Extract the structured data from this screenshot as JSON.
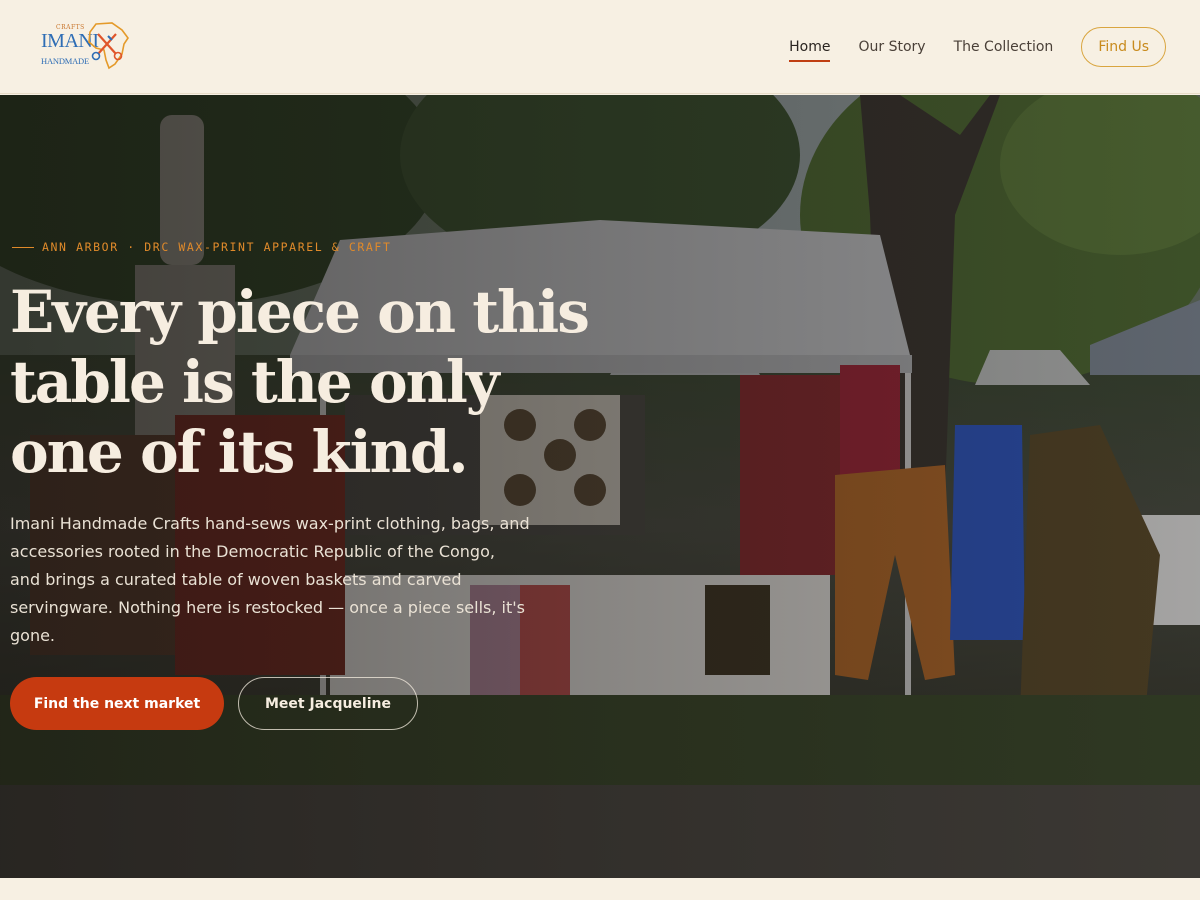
{
  "brand": {
    "logo_small": "CRAFTS",
    "logo_main": "IMANI",
    "logo_sub": "HANDMADE"
  },
  "nav": {
    "items": [
      {
        "label": "Home",
        "active": true
      },
      {
        "label": "Our Story",
        "active": false
      },
      {
        "label": "The Collection",
        "active": false
      }
    ],
    "cta_label": "Find Us"
  },
  "hero": {
    "eyebrow": "ANN ARBOR · DRC WAX-PRINT APPAREL & CRAFT",
    "headline": "Every piece on this table is the only one of its kind.",
    "lede": "Imani Handmade Crafts hand-sews wax-print clothing, bags, and accessories rooted in the Democratic Republic of the Congo, and brings a curated table of woven baskets and carved servingware. Nothing here is restocked — once a piece sells, it's gone.",
    "primary_cta": "Find the next market",
    "secondary_cta": "Meet Jacqueline"
  },
  "colors": {
    "accent": "#c63a10",
    "gold": "#d9a53f",
    "cream": "#f7f0e3",
    "brand_blue": "#2e6db5"
  }
}
